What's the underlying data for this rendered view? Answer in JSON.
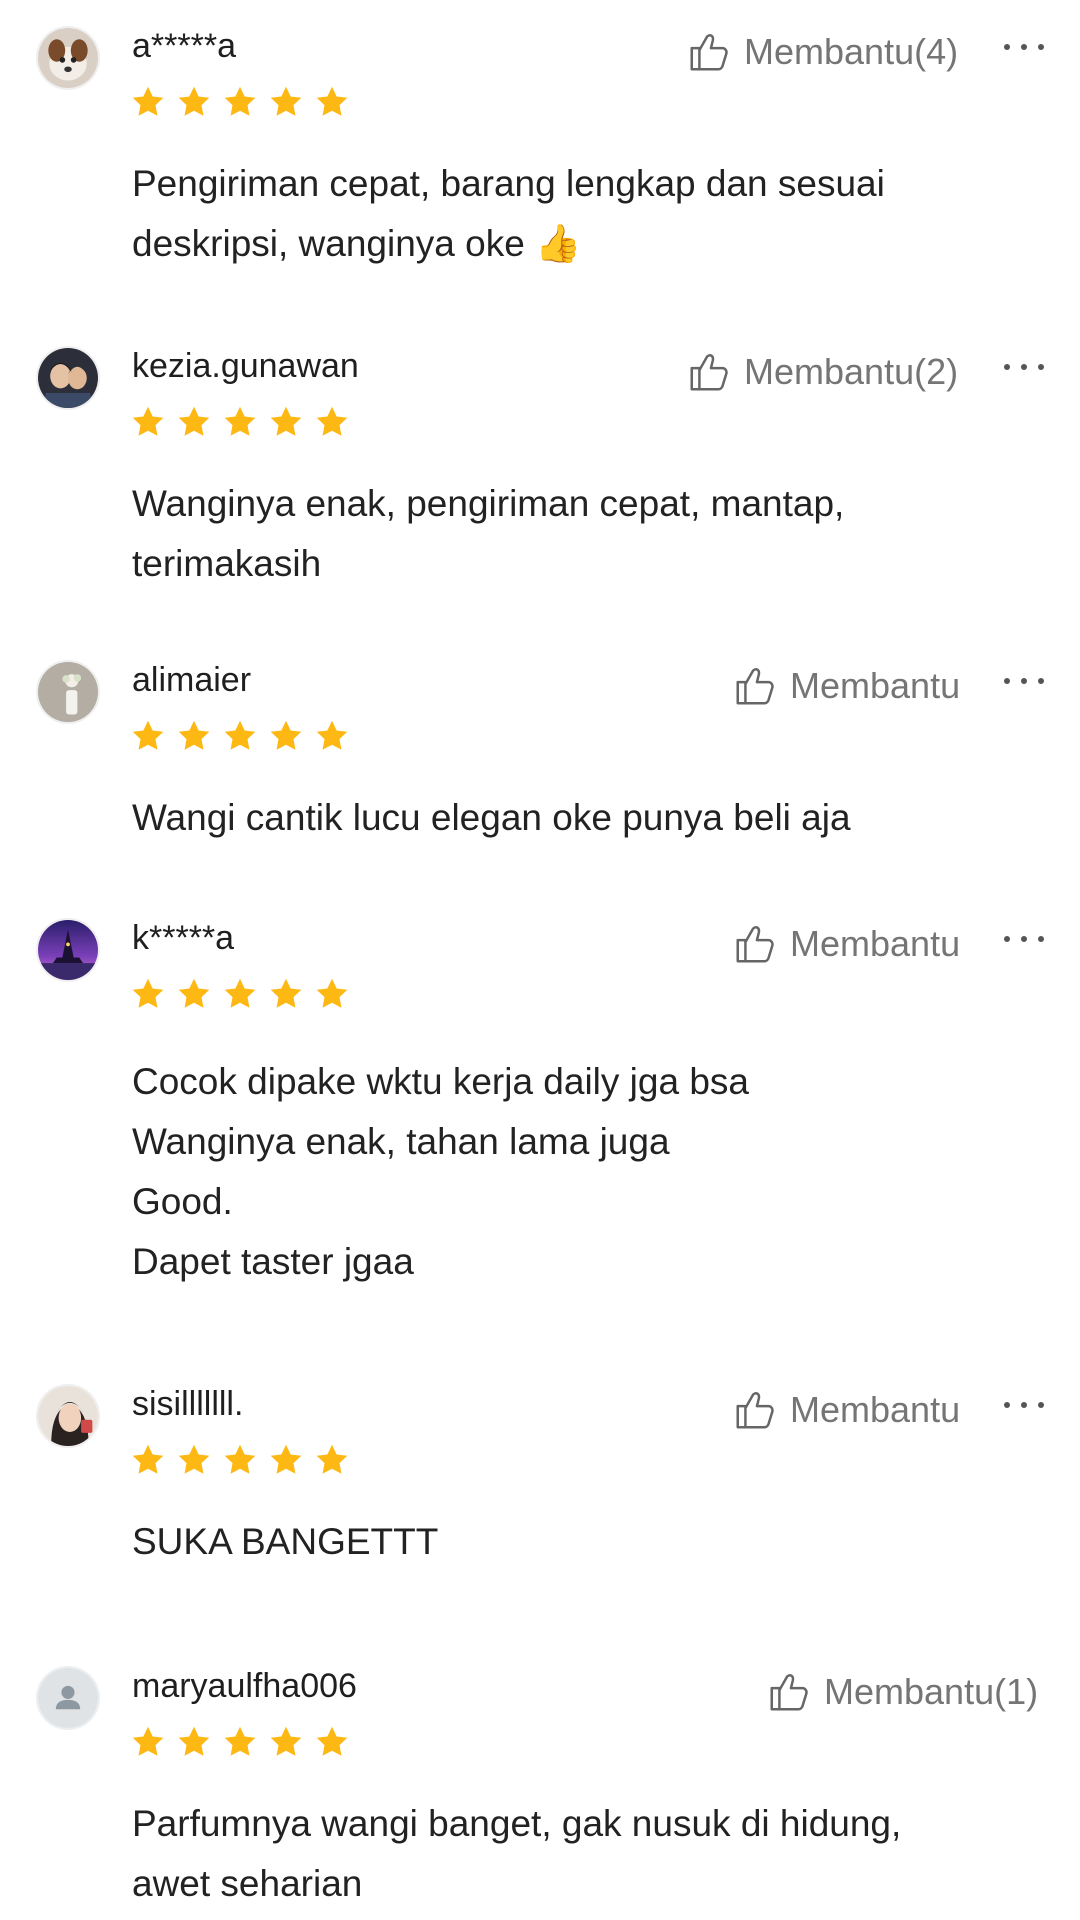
{
  "colors": {
    "star": "#FDB813",
    "helpful_text": "#757575",
    "username": "#1f1f1f"
  },
  "reviews": [
    {
      "username": "a*****a",
      "rating": 5,
      "helpful_label": "Membantu(4)",
      "avatar_icon": "dog-photo-avatar",
      "comment_lines": [
        "Pengiriman cepat, barang lengkap dan sesuai",
        "deskripsi, wanginya oke 👍"
      ]
    },
    {
      "username": "kezia.gunawan",
      "rating": 5,
      "helpful_label": "Membantu(2)",
      "avatar_icon": "person-photo-avatar",
      "comment_lines": [
        "Wanginya enak, pengiriman cepat, mantap,",
        "terimakasih"
      ]
    },
    {
      "username": "alimaier",
      "rating": 5,
      "helpful_label": "Membantu",
      "avatar_icon": "flower-photo-avatar",
      "comment_lines": [
        "Wangi cantik lucu elegan oke punya beli aja"
      ]
    },
    {
      "username": "k*****a",
      "rating": 5,
      "helpful_label": "Membantu",
      "avatar_icon": "tower-night-photo-avatar",
      "comment_lines": [
        "Cocok dipake wktu kerja daily jga bsa",
        "Wanginya enak, tahan lama juga",
        "Good.",
        "Dapet taster jgaa"
      ]
    },
    {
      "username": "sisilllllll.",
      "rating": 5,
      "helpful_label": "Membantu",
      "avatar_icon": "person-photo-avatar",
      "comment_lines": [
        "SUKA BANGETTT"
      ]
    },
    {
      "username": "maryaulfha006",
      "rating": 5,
      "helpful_label": "Membantu(1)",
      "avatar_icon": "default-user-avatar",
      "comment_lines": [
        "Parfumnya wangi banget, gak nusuk di hidung,",
        "awet seharian"
      ]
    }
  ]
}
